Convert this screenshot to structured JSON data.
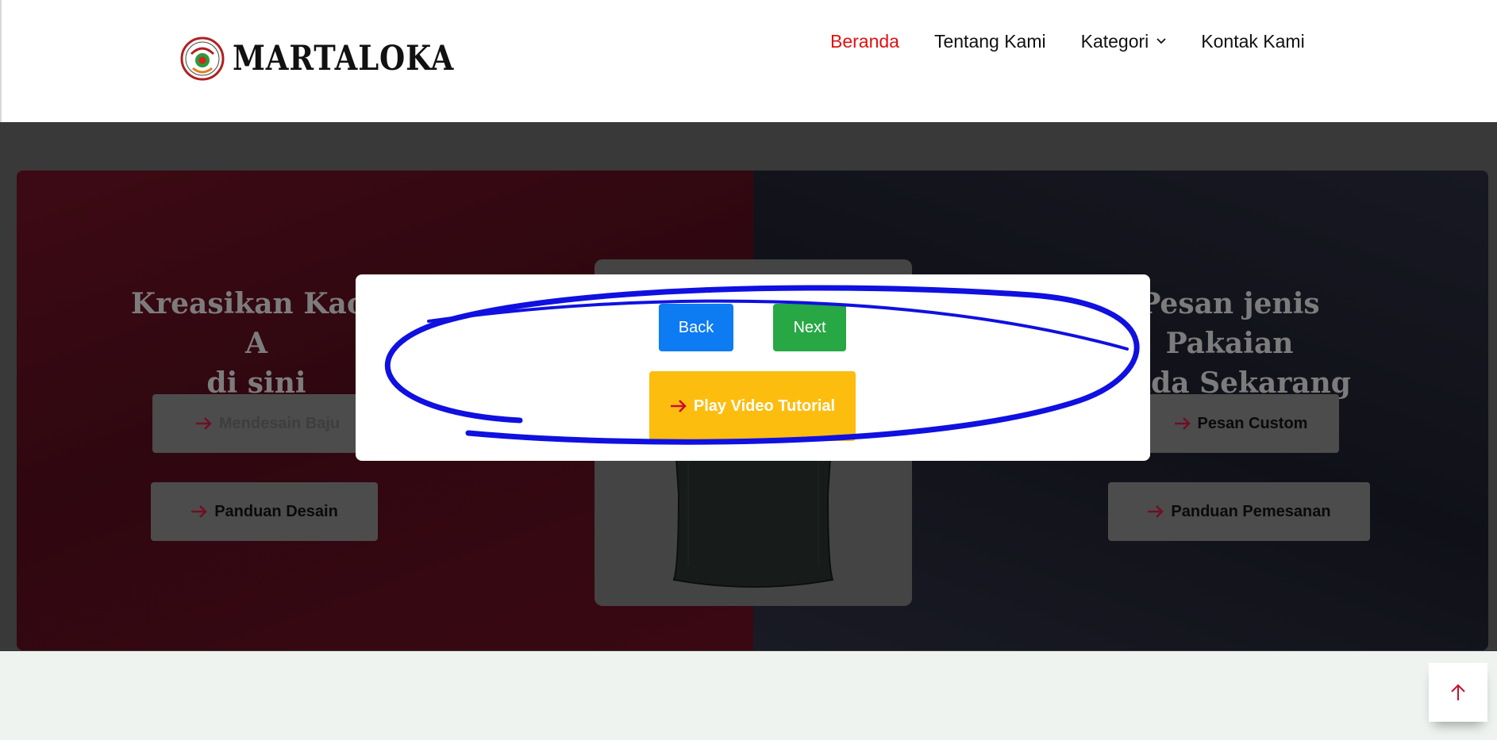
{
  "brand": {
    "name": "MARTALOKA",
    "logo_icon": "martaloka-seal-logo"
  },
  "nav": {
    "items": [
      {
        "label": "Beranda",
        "active": true
      },
      {
        "label": "Tentang Kami",
        "active": false
      },
      {
        "label": "Kategori",
        "active": false,
        "has_dropdown": true
      },
      {
        "label": "Kontak Kami",
        "active": false
      }
    ]
  },
  "hero": {
    "left": {
      "title_line1": "Kreasikan Kaos A",
      "title_line2": "di sini",
      "buttons": [
        "Mendesain Baju",
        "Panduan Desain"
      ]
    },
    "right": {
      "title_line1": "Pesan jenis Pakaian",
      "title_line2": "Anda Sekarang",
      "buttons": [
        "Pesan Custom",
        "Panduan Pemesanan"
      ]
    }
  },
  "modal": {
    "back_label": "Back",
    "next_label": "Next",
    "play_label": "Play Video Tutorial"
  },
  "scroll_top": {
    "icon": "arrow-up-icon"
  },
  "colors": {
    "nav_active": "#e01010",
    "back": "#0d7bf2",
    "next": "#28a745",
    "play": "#fdbd0f",
    "arrow": "#c8102e",
    "annotation": "#1010e0"
  }
}
